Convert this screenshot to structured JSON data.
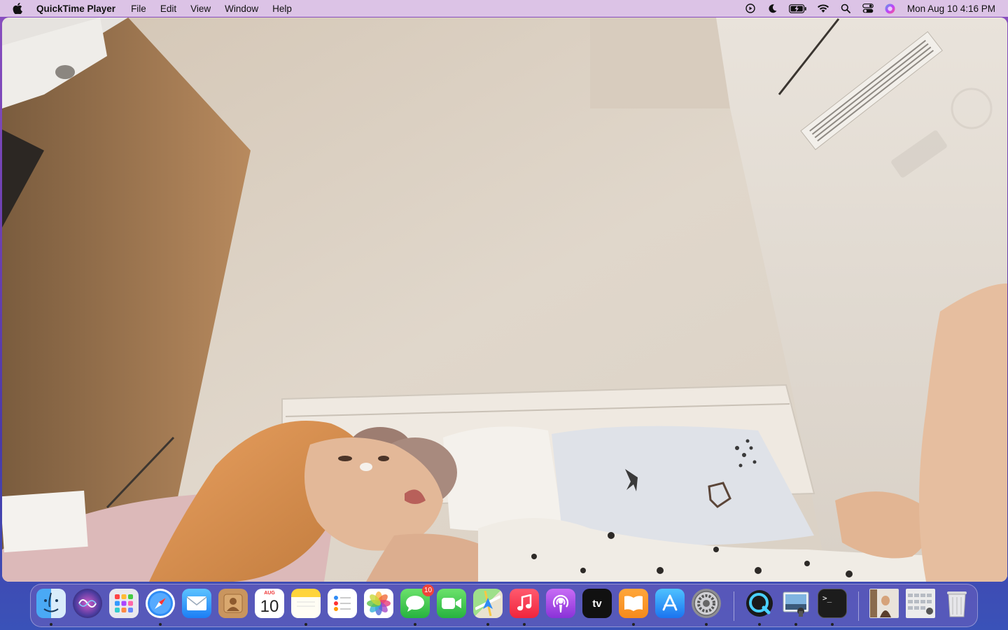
{
  "menubar": {
    "app_name": "QuickTime Player",
    "menus": [
      "File",
      "Edit",
      "View",
      "Window",
      "Help"
    ],
    "clock": "Mon Aug 10  4:16 PM",
    "status_icons": [
      "screen-recording-icon",
      "do-not-disturb-icon",
      "battery-charging-icon",
      "wifi-icon",
      "spotlight-icon",
      "control-center-icon",
      "siri-icon"
    ]
  },
  "video": {
    "description_icon": "video-frame"
  },
  "dock": {
    "apps": [
      {
        "name": "Finder",
        "icon": "finder-icon",
        "running": true
      },
      {
        "name": "Siri",
        "icon": "siri-icon",
        "running": false
      },
      {
        "name": "Launchpad",
        "icon": "launchpad-icon",
        "running": false
      },
      {
        "name": "Safari",
        "icon": "safari-icon",
        "running": true
      },
      {
        "name": "Mail",
        "icon": "mail-icon",
        "running": false
      },
      {
        "name": "Contacts",
        "icon": "contacts-icon",
        "running": false
      },
      {
        "name": "Calendar",
        "icon": "calendar-icon",
        "running": false,
        "month": "AUG",
        "day": "10"
      },
      {
        "name": "Notes",
        "icon": "notes-icon",
        "running": true
      },
      {
        "name": "Reminders",
        "icon": "reminders-icon",
        "running": false
      },
      {
        "name": "Photos",
        "icon": "photos-icon",
        "running": false
      },
      {
        "name": "Messages",
        "icon": "messages-icon",
        "running": true,
        "badge": "10"
      },
      {
        "name": "FaceTime",
        "icon": "facetime-icon",
        "running": false
      },
      {
        "name": "Maps",
        "icon": "maps-icon",
        "running": true
      },
      {
        "name": "Music",
        "icon": "music-icon",
        "running": true
      },
      {
        "name": "Podcasts",
        "icon": "podcasts-icon",
        "running": false
      },
      {
        "name": "TV",
        "icon": "apple-tv-icon",
        "running": false,
        "label": "tv"
      },
      {
        "name": "Books",
        "icon": "books-icon",
        "running": true
      },
      {
        "name": "App Store",
        "icon": "app-store-icon",
        "running": false
      },
      {
        "name": "System Preferences",
        "icon": "system-preferences-icon",
        "running": true
      },
      {
        "name": "QuickTime Player",
        "icon": "quicktime-icon",
        "running": true
      },
      {
        "name": "Preview",
        "icon": "preview-icon",
        "running": true
      },
      {
        "name": "Terminal",
        "icon": "terminal-icon",
        "running": true,
        "label": ">_"
      }
    ],
    "recent": [
      {
        "name": "Photo thumbnail",
        "icon": "photo-thumbnail-icon"
      },
      {
        "name": "Downloads stack",
        "icon": "downloads-stack-icon"
      },
      {
        "name": "Trash",
        "icon": "trash-icon"
      }
    ]
  },
  "colors": {
    "menubar_bg": "#dcc3e6",
    "desktop_top": "#8a4fc0",
    "desktop_bottom": "#3a52b8",
    "badge_red": "#f0433a"
  }
}
